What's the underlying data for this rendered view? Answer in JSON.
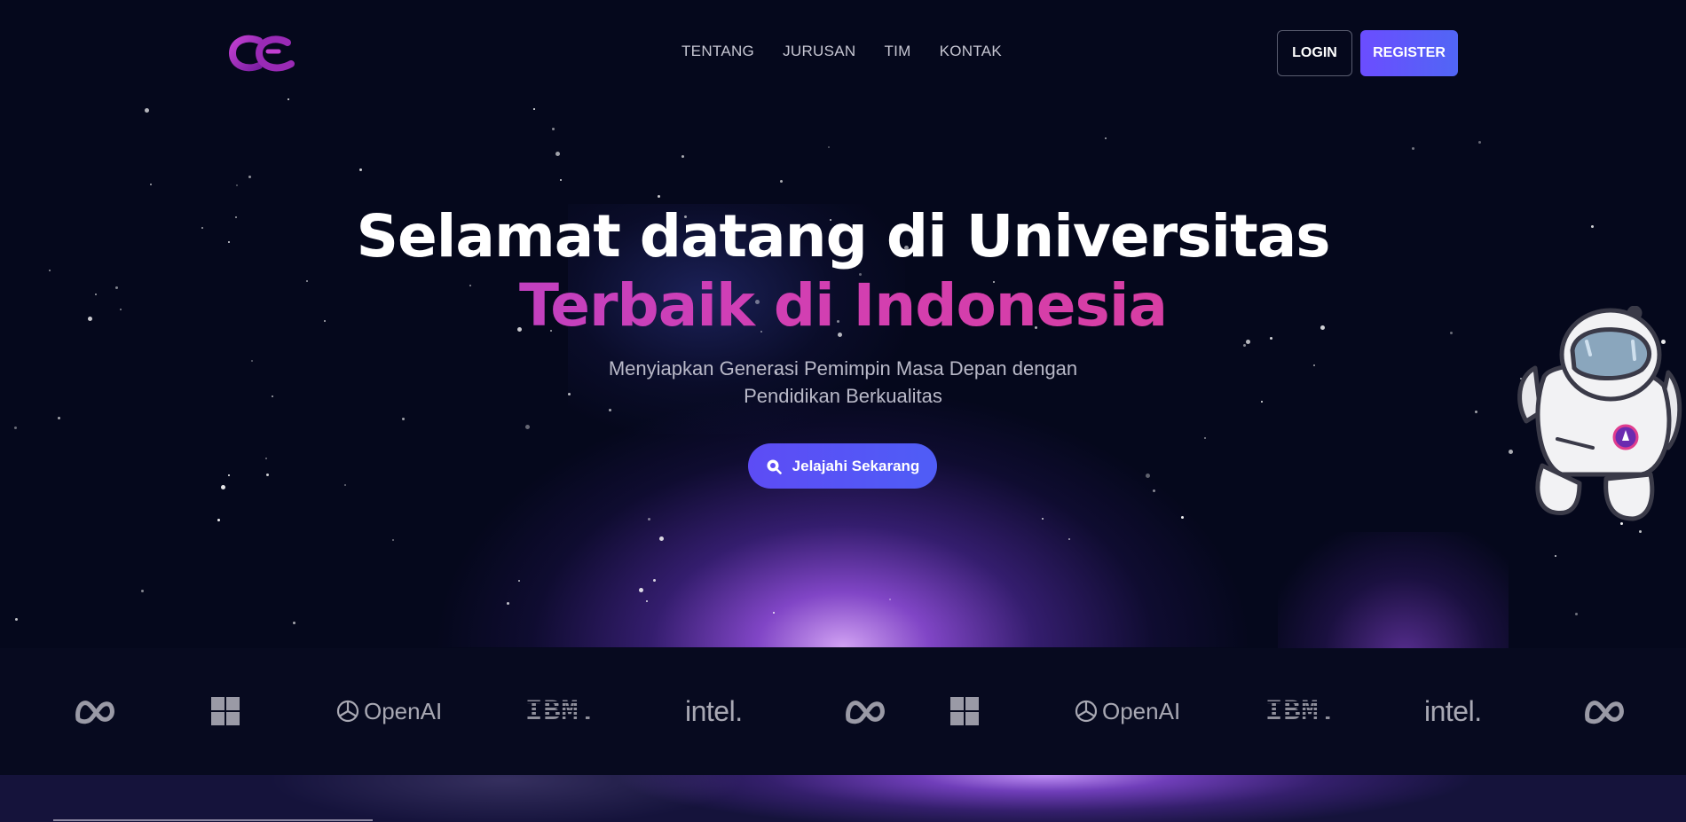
{
  "nav": {
    "links": [
      "TENTANG",
      "JURUSAN",
      "TIM",
      "KONTAK"
    ],
    "login_label": "LOGIN",
    "register_label": "REGISTER"
  },
  "hero": {
    "title_line1": "Selamat datang di Universitas",
    "title_line2": "Terbaik di Indonesia",
    "subtitle": "Menyiapkan Generasi Pemimpin Masa Depan dengan Pendidikan Berkualitas",
    "cta_label": "Jelajahi Sekarang",
    "cta_icon": "search-icon"
  },
  "partners": {
    "openai_label": "OpenAI",
    "ibm_label": "IBM.",
    "intel_label": "intel.",
    "logos": [
      "meta",
      "windows",
      "openai",
      "ibm",
      "intel",
      "meta",
      "windows",
      "openai",
      "ibm",
      "intel",
      "meta"
    ]
  },
  "colors": {
    "background": "#05081c",
    "accent": "#5d4cf5",
    "title_gradient_start": "#a142d8",
    "title_gradient_end": "#e03d8e",
    "logo_color": "#9a9aa6"
  }
}
